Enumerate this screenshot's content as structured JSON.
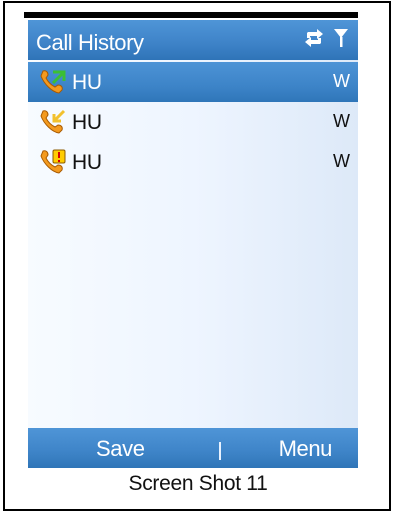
{
  "window": {
    "title": "Call History",
    "status_icons": [
      "sync-icon",
      "signal-icon"
    ]
  },
  "calls": [
    {
      "type": "outgoing-call-icon",
      "name": "HU",
      "time": "W",
      "selected": true
    },
    {
      "type": "incoming-call-icon",
      "name": "HU",
      "time": "W",
      "selected": false
    },
    {
      "type": "missed-call-icon",
      "name": "HU",
      "time": "W",
      "selected": false
    }
  ],
  "softkeys": {
    "left": "Save",
    "right": "Menu"
  },
  "caption": "Screen Shot 11",
  "colors": {
    "title_blue": "#3f84c9",
    "selection_blue": "#3d84c8",
    "background": "#eef5ff",
    "phone_orange": "#f39a1f",
    "green_arrow": "#3bbf34",
    "missed_badge": "#ffcc00"
  }
}
